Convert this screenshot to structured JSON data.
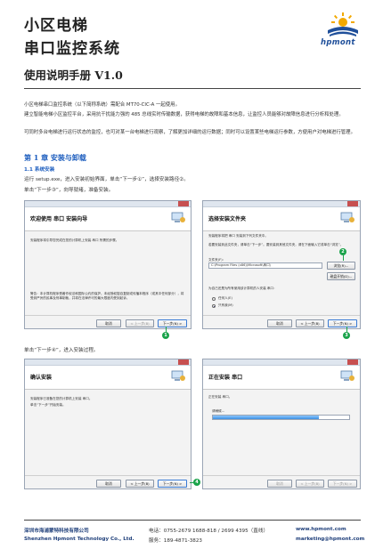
{
  "header": {
    "title_line1": "小区电梯",
    "title_line2": "串口监控系统",
    "subtitle": "使用说明手册 V1.0",
    "logo_text": "hpmont"
  },
  "intro": {
    "p1": "小区电梯串口监控系统（以下简称系统）需配合 MT70-CIC-A 一起使用。",
    "p2": "建立智能电梯小区监控平台，采用抗干扰能力强的 485 总线实时传输数据，获得电梯的故障和基本信息，让监控人员能够对故障信息进行分析和处理。",
    "p3": "可同时多台电梯进行运行状态的监控，也可对某一台电梯进行观察，了解更加详细的运行数据；同时可以设置某些电梯运行参数，方便用户对电梯进行管理。"
  },
  "chapter": {
    "title": "第 1 章  安装与卸载",
    "section": "1.1  系统安装",
    "step1": "运行 setup.exe，进入安装初始界面，单击“下一步①”，选择安装路径②。",
    "step2": "单击“下一步③”，向导就绪，准备安装。",
    "step3": "单击“下一步④”，进入安装过程。"
  },
  "dialogs": {
    "welcome": {
      "title": "欢迎使用 串口 安装向导",
      "text1": "安装程序将引导您完成在您的计算机上安装 串口 所需的步骤。",
      "text2": "警告：本计算机程序受著作权法和国际公约的保护。未经授权擅自复制或传播本程序（或其中任何部分），将受到严厉的民事及刑事制裁，并将在法律许可的最大限度内受到起诉。",
      "cancel": "取消",
      "back": "< 上一步(B)",
      "next": "下一步(N) >"
    },
    "folder": {
      "title": "选择安装文件夹",
      "text1": "安装程序将把 串口 安装到下列文件夹中。",
      "text2": "若要安装到此文件夹，请单击“下一步”。要安装到其他文件夹，请在下面输入它或单击“浏览”。",
      "folder_label": "文件夹(F):",
      "folder_value": "C:\\Program Files (x86)\\Microsoft\\串口\\",
      "browse": "浏览(R)...",
      "disk_cost": "磁盘开销(D)...",
      "install_for": "为自己还是为所有使用该计算机的人安装 串口：",
      "opt_everyone": "任何人(E)",
      "opt_me": "只有我(M)",
      "cancel": "取消",
      "back": "< 上一步(B)",
      "next": "下一步(N) >"
    },
    "confirm": {
      "title": "确认安装",
      "text1": "安装程序已准备在您的计算机上安装 串口。",
      "text2": "单击“下一步”开始安装。",
      "cancel": "取消",
      "back": "< 上一步(B)",
      "next": "下一步(N) >"
    },
    "installing": {
      "title": "正在安装 串口",
      "text1": "正在安装 串口。",
      "text2": "请稍候...",
      "progress": 0.78,
      "cancel": "取消",
      "back": "< 上一步(B)",
      "next": "下一步(N) >"
    }
  },
  "badges": [
    "1",
    "2",
    "3",
    "4"
  ],
  "footer": {
    "company_cn": "深圳市海浦蒙特科技有限公司",
    "company_en": "Shenzhen Hpmont Technology Co., Ltd.",
    "phone": "电话：0755-2679 1688-818 / 2699 4395（直线）",
    "service": "服务：189-4871-3823",
    "website": "www.hpmont.com",
    "email": "marketing@hpmont.com"
  },
  "colors": {
    "accent": "#1f5fbf",
    "badge": "#1aa34a",
    "logo": "#1f4f9a"
  }
}
